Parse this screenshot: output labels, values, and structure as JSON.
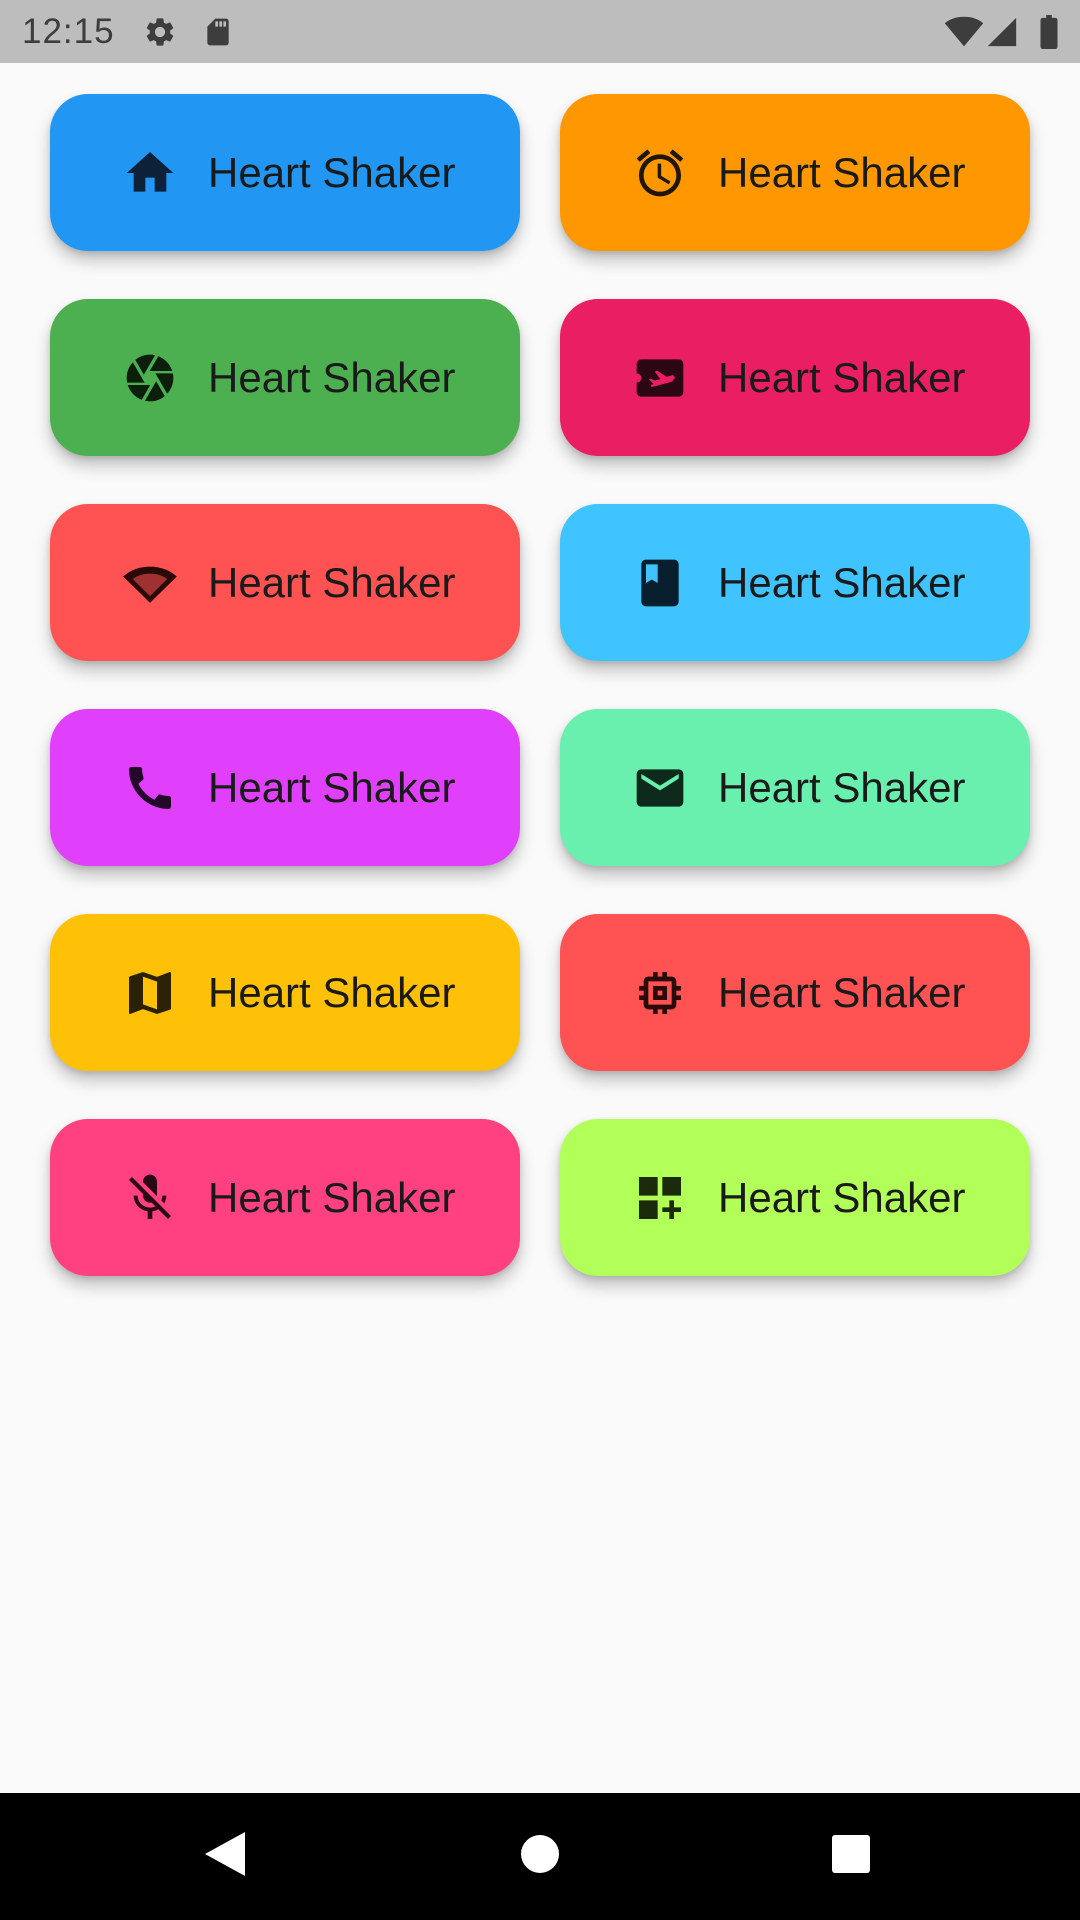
{
  "status_bar": {
    "time": "12:15",
    "left_icons": [
      "gear-icon",
      "sd-card-icon"
    ],
    "right_icons": [
      "wifi-icon",
      "signal-icon",
      "battery-icon"
    ],
    "background": "#bdbdbd"
  },
  "buttons": [
    {
      "label": "Heart Shaker",
      "icon": "home-icon",
      "color": "#2196f3"
    },
    {
      "label": "Heart Shaker",
      "icon": "alarm-icon",
      "color": "#ff9800"
    },
    {
      "label": "Heart Shaker",
      "icon": "camera-aperture-icon",
      "color": "#4caf50"
    },
    {
      "label": "Heart Shaker",
      "icon": "airplane-ticket-icon",
      "color": "#e91e63"
    },
    {
      "label": "Heart Shaker",
      "icon": "wifi-icon",
      "color": "#ff5252"
    },
    {
      "label": "Heart Shaker",
      "icon": "book-icon",
      "color": "#40c4ff"
    },
    {
      "label": "Heart Shaker",
      "icon": "phone-icon",
      "color": "#e040fb"
    },
    {
      "label": "Heart Shaker",
      "icon": "mail-icon",
      "color": "#69f0ae"
    },
    {
      "label": "Heart Shaker",
      "icon": "map-icon",
      "color": "#ffc107"
    },
    {
      "label": "Heart Shaker",
      "icon": "memory-chip-icon",
      "color": "#ff5252"
    },
    {
      "label": "Heart Shaker",
      "icon": "mic-off-icon",
      "color": "#ff4081"
    },
    {
      "label": "Heart Shaker",
      "icon": "dashboard-add-icon",
      "color": "#b2ff59"
    }
  ],
  "nav_bar": {
    "buttons": [
      "back-icon",
      "home-circle-icon",
      "recents-icon"
    ]
  }
}
